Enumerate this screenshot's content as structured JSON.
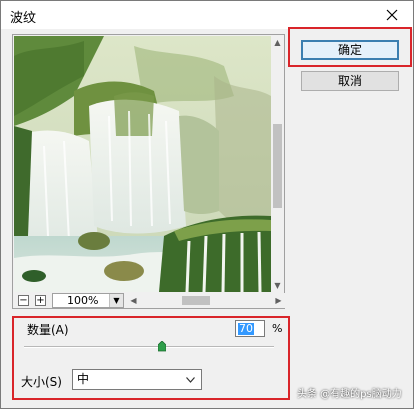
{
  "window": {
    "title": "波纹",
    "close_icon": "close-icon"
  },
  "buttons": {
    "ok_label": "确定",
    "cancel_label": "取消"
  },
  "preview": {
    "zoom_out_label": "−",
    "zoom_in_label": "+",
    "zoom_value": "100%"
  },
  "controls": {
    "amount_label": "数量(A)",
    "amount_value": "70",
    "amount_unit": "%",
    "amount_slider_fraction": 0.55,
    "size_label": "大小(S)",
    "size_value": "中"
  },
  "watermark": "头条 @有趣的ps脑动力",
  "colors": {
    "highlight_frame": "#d9252a",
    "ok_border": "#3c7fb1"
  }
}
